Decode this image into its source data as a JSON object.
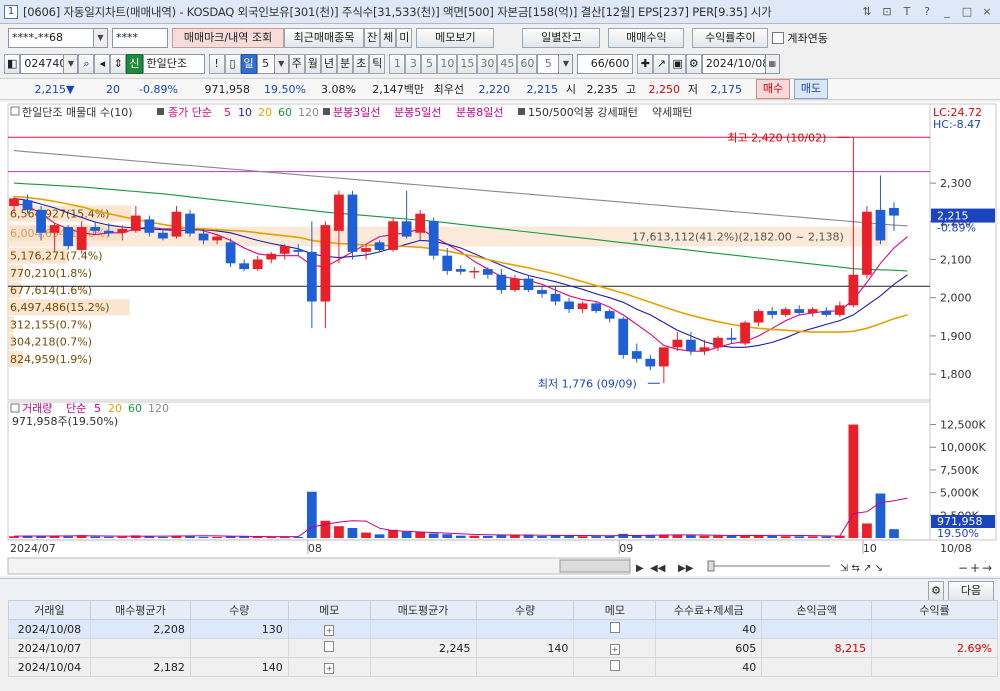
{
  "titlebar": {
    "icon": "1",
    "text": "[0606] 자동일지차트(매매내역) - KOSDAQ 외국인보유[301(천)] 주식수[31,533(천)] 액면[500] 자본금[158(억)] 결산[12월] EPS[237] PER[9.35] 시가",
    "buttons": [
      "⇅",
      "⊡",
      "T",
      "?",
      "_",
      "□",
      "×"
    ]
  },
  "toolbar1": {
    "account": "****-**68",
    "password": "****",
    "trade_mark_button": "매매마크/내역 조회",
    "recent_items_button": "최근매매종목",
    "balance_button": "잔",
    "fill_button": "체",
    "unfilled_button": "미",
    "memo_button": "메모보기",
    "daily_balance_button": "일별잔고",
    "trade_profit_button": "매매수익",
    "profit_trend_button": "수익률추이",
    "account_link_label": "계좌연동"
  },
  "toolbar2": {
    "code": "024740",
    "new_badge": "신",
    "stock_name": "한일단조",
    "period_day": "일",
    "period_count": "5",
    "periods": [
      "주",
      "월",
      "년",
      "분",
      "초",
      "틱"
    ],
    "intervals": [
      "1",
      "3",
      "5",
      "10",
      "15",
      "30",
      "45",
      "60"
    ],
    "interval_value": "5",
    "count": "66/600",
    "date": "2024/10/08"
  },
  "quotebar": {
    "price": "2,215",
    "arrow": "▼",
    "change": "20",
    "change_pct": "-0.89%",
    "volume": "971,958",
    "volume_ratio": "19.50%",
    "turnover": "3.08%",
    "amount": "2,147백만",
    "best_ask_label": "최우선",
    "best_ask": "2,220",
    "best_bid": "2,215",
    "open_label": "시",
    "open": "2,235",
    "high_label": "고",
    "high": "2,250",
    "low_label": "저",
    "low": "2,175",
    "buy_button": "매수",
    "sell_button": "매도"
  },
  "legend": {
    "series_title": "한일단조 매물대 수(10)",
    "ma_label": "종가 단순",
    "ma_periods": [
      "5",
      "10",
      "20",
      "60",
      "120"
    ],
    "vwap3": "분봉3일선",
    "vwap5": "분봉5일선",
    "vwap8": "분봉8일선",
    "pattern": "150/500억봉 강세패턴",
    "pattern2": "약세패턴"
  },
  "annotations": {
    "lc": "LC:24.72",
    "hc": "HC:-8.47",
    "high_mark": "최고 2,420 (10/02)",
    "low_mark": "최저 1,776 (09/09)",
    "price_tag": "2,215",
    "price_tag_pct": "-0.89%",
    "vol_tag": "971,958",
    "vol_tag_pct": "19.50%",
    "vol_legend_title": "거래량",
    "vol_legend_ma": "단순",
    "vol_ma_periods": [
      "5",
      "20",
      "60",
      "120"
    ],
    "vol_current": "971,958주(19.50%)"
  },
  "profile": [
    {
      "label": "6,564,927(15.4%)",
      "price": 2220
    },
    {
      "label": "6,004,694(14.0%)",
      "price": 2170
    },
    {
      "label": "5,176,271(7.4%)",
      "price": 2110
    },
    {
      "label": "770,210(1.8%)",
      "price": 2065
    },
    {
      "label": "677,614(1.6%)",
      "price": 2020
    },
    {
      "label": "6,497,486(15.2%)",
      "price": 1975
    },
    {
      "label": "312,155(0.7%)",
      "price": 1930
    },
    {
      "label": "304,218(0.7%)",
      "price": 1885
    },
    {
      "label": "824,959(1.9%)",
      "price": 1840
    }
  ],
  "profile_highlight": "17,613,112(41.2%)(2,182.00 ~ 2,138)",
  "chart_data": {
    "type": "candlestick",
    "price_axis": {
      "ticks": [
        "2,300",
        "2,200",
        "2,100",
        "2,000",
        "1,900",
        "1,800"
      ],
      "ylim": [
        1740,
        2460
      ]
    },
    "volume_axis": {
      "ticks": [
        "12,500K",
        "10,000K",
        "7,500K",
        "5,000K",
        "2,500K"
      ],
      "ylim": [
        0,
        13000
      ]
    },
    "date_labels": [
      "2024/07",
      "08",
      "09",
      "10",
      "10/08"
    ],
    "candles": [
      {
        "o": 2240,
        "h": 2265,
        "l": 2225,
        "c": 2260,
        "v": 190
      },
      {
        "o": 2255,
        "h": 2270,
        "l": 2220,
        "c": 2230,
        "v": 170
      },
      {
        "o": 2230,
        "h": 2240,
        "l": 2150,
        "c": 2170,
        "v": 260
      },
      {
        "o": 2170,
        "h": 2195,
        "l": 2120,
        "c": 2190,
        "v": 210
      },
      {
        "o": 2185,
        "h": 2190,
        "l": 2125,
        "c": 2135,
        "v": 180
      },
      {
        "o": 2125,
        "h": 2200,
        "l": 2115,
        "c": 2185,
        "v": 310
      },
      {
        "o": 2185,
        "h": 2200,
        "l": 2165,
        "c": 2175,
        "v": 160
      },
      {
        "o": 2175,
        "h": 2195,
        "l": 2160,
        "c": 2168,
        "v": 140
      },
      {
        "o": 2170,
        "h": 2190,
        "l": 2150,
        "c": 2180,
        "v": 150
      },
      {
        "o": 2175,
        "h": 2240,
        "l": 2170,
        "c": 2215,
        "v": 290
      },
      {
        "o": 2205,
        "h": 2215,
        "l": 2160,
        "c": 2170,
        "v": 220
      },
      {
        "o": 2170,
        "h": 2180,
        "l": 2150,
        "c": 2155,
        "v": 130
      },
      {
        "o": 2160,
        "h": 2240,
        "l": 2155,
        "c": 2225,
        "v": 260
      },
      {
        "o": 2220,
        "h": 2230,
        "l": 2160,
        "c": 2168,
        "v": 230
      },
      {
        "o": 2168,
        "h": 2180,
        "l": 2140,
        "c": 2150,
        "v": 130
      },
      {
        "o": 2150,
        "h": 2165,
        "l": 2140,
        "c": 2160,
        "v": 120
      },
      {
        "o": 2145,
        "h": 2155,
        "l": 2080,
        "c": 2090,
        "v": 200
      },
      {
        "o": 2090,
        "h": 2100,
        "l": 2070,
        "c": 2075,
        "v": 170
      },
      {
        "o": 2075,
        "h": 2110,
        "l": 2070,
        "c": 2100,
        "v": 150
      },
      {
        "o": 2100,
        "h": 2120,
        "l": 2090,
        "c": 2115,
        "v": 140
      },
      {
        "o": 2115,
        "h": 2140,
        "l": 2100,
        "c": 2135,
        "v": 120
      },
      {
        "o": 2125,
        "h": 2140,
        "l": 2110,
        "c": 2120,
        "v": 110
      },
      {
        "o": 2120,
        "h": 2200,
        "l": 1920,
        "c": 1990,
        "v": 5100
      },
      {
        "o": 1990,
        "h": 2200,
        "l": 1920,
        "c": 2190,
        "v": 1900
      },
      {
        "o": 2175,
        "h": 2280,
        "l": 2090,
        "c": 2270,
        "v": 1300
      },
      {
        "o": 2270,
        "h": 2280,
        "l": 2100,
        "c": 2120,
        "v": 1100
      },
      {
        "o": 2120,
        "h": 2140,
        "l": 2100,
        "c": 2130,
        "v": 600
      },
      {
        "o": 2145,
        "h": 2150,
        "l": 2120,
        "c": 2125,
        "v": 400
      },
      {
        "o": 2125,
        "h": 2210,
        "l": 2120,
        "c": 2200,
        "v": 900
      },
      {
        "o": 2200,
        "h": 2280,
        "l": 2155,
        "c": 2160,
        "v": 700
      },
      {
        "o": 2170,
        "h": 2230,
        "l": 2150,
        "c": 2220,
        "v": 650
      },
      {
        "o": 2200,
        "h": 2210,
        "l": 2100,
        "c": 2110,
        "v": 500
      },
      {
        "o": 2110,
        "h": 2130,
        "l": 2060,
        "c": 2070,
        "v": 420
      },
      {
        "o": 2075,
        "h": 2085,
        "l": 2060,
        "c": 2068,
        "v": 260
      },
      {
        "o": 2068,
        "h": 2080,
        "l": 2050,
        "c": 2070,
        "v": 250
      },
      {
        "o": 2075,
        "h": 2080,
        "l": 2050,
        "c": 2060,
        "v": 230
      },
      {
        "o": 2060,
        "h": 2075,
        "l": 2010,
        "c": 2020,
        "v": 330
      },
      {
        "o": 2020,
        "h": 2060,
        "l": 2015,
        "c": 2050,
        "v": 310
      },
      {
        "o": 2050,
        "h": 2060,
        "l": 2015,
        "c": 2020,
        "v": 290
      },
      {
        "o": 2020,
        "h": 2030,
        "l": 2000,
        "c": 2010,
        "v": 220
      },
      {
        "o": 2010,
        "h": 2030,
        "l": 1980,
        "c": 1990,
        "v": 300
      },
      {
        "o": 1990,
        "h": 2000,
        "l": 1960,
        "c": 1970,
        "v": 260
      },
      {
        "o": 1970,
        "h": 1990,
        "l": 1960,
        "c": 1985,
        "v": 200
      },
      {
        "o": 1985,
        "h": 1990,
        "l": 1960,
        "c": 1965,
        "v": 210
      },
      {
        "o": 1965,
        "h": 1970,
        "l": 1935,
        "c": 1945,
        "v": 250
      },
      {
        "o": 1945,
        "h": 1950,
        "l": 1840,
        "c": 1850,
        "v": 460
      },
      {
        "o": 1860,
        "h": 1880,
        "l": 1830,
        "c": 1840,
        "v": 320
      },
      {
        "o": 1840,
        "h": 1850,
        "l": 1810,
        "c": 1820,
        "v": 280
      },
      {
        "o": 1820,
        "h": 1870,
        "l": 1776,
        "c": 1870,
        "v": 380
      },
      {
        "o": 1870,
        "h": 1910,
        "l": 1860,
        "c": 1890,
        "v": 330
      },
      {
        "o": 1890,
        "h": 1910,
        "l": 1850,
        "c": 1860,
        "v": 300
      },
      {
        "o": 1860,
        "h": 1890,
        "l": 1850,
        "c": 1870,
        "v": 250
      },
      {
        "o": 1870,
        "h": 1900,
        "l": 1860,
        "c": 1895,
        "v": 260
      },
      {
        "o": 1895,
        "h": 1920,
        "l": 1880,
        "c": 1890,
        "v": 240
      },
      {
        "o": 1880,
        "h": 1940,
        "l": 1875,
        "c": 1935,
        "v": 330
      },
      {
        "o": 1935,
        "h": 1970,
        "l": 1925,
        "c": 1965,
        "v": 340
      },
      {
        "o": 1965,
        "h": 1975,
        "l": 1945,
        "c": 1955,
        "v": 220
      },
      {
        "o": 1955,
        "h": 1975,
        "l": 1950,
        "c": 1970,
        "v": 200
      },
      {
        "o": 1970,
        "h": 1980,
        "l": 1955,
        "c": 1960,
        "v": 190
      },
      {
        "o": 1960,
        "h": 1975,
        "l": 1950,
        "c": 1970,
        "v": 180
      },
      {
        "o": 1965,
        "h": 1975,
        "l": 1950,
        "c": 1955,
        "v": 170
      },
      {
        "o": 1955,
        "h": 1990,
        "l": 1950,
        "c": 1980,
        "v": 260
      },
      {
        "o": 1980,
        "h": 2420,
        "l": 1975,
        "c": 2060,
        "v": 12500
      },
      {
        "o": 2060,
        "h": 2240,
        "l": 2050,
        "c": 2225,
        "v": 1600
      },
      {
        "o": 2230,
        "h": 2320,
        "l": 2140,
        "c": 2150,
        "v": 4900
      },
      {
        "o": 2235,
        "h": 2250,
        "l": 2175,
        "c": 2215,
        "v": 972
      }
    ],
    "ma_lines": [
      {
        "name": "5",
        "color": "#e4007f",
        "values": [
          2248,
          2240,
          2220,
          2195,
          2180,
          2170,
          2165,
          2170,
          2170,
          2180,
          2185,
          2180,
          2180,
          2185,
          2175,
          2165,
          2150,
          2130,
          2115,
          2110,
          2110,
          2110,
          2085,
          2080,
          2100,
          2120,
          2140,
          2160,
          2165,
          2170,
          2180,
          2160,
          2140,
          2120,
          2095,
          2075,
          2055,
          2050,
          2045,
          2035,
          2020,
          2005,
          1995,
          1990,
          1975,
          1955,
          1930,
          1905,
          1875,
          1865,
          1860,
          1860,
          1870,
          1880,
          1885,
          1900,
          1920,
          1940,
          1955,
          1960,
          1965,
          1965,
          1995,
          2040,
          2090,
          2130,
          2160
        ]
      },
      {
        "name": "10",
        "color": "#1e1eaa",
        "values": [
          2260,
          2255,
          2245,
          2235,
          2222,
          2210,
          2198,
          2190,
          2185,
          2182,
          2180,
          2178,
          2176,
          2177,
          2178,
          2175,
          2170,
          2160,
          2150,
          2142,
          2135,
          2128,
          2115,
          2108,
          2105,
          2108,
          2112,
          2120,
          2130,
          2140,
          2150,
          2148,
          2140,
          2130,
          2115,
          2100,
          2085,
          2070,
          2058,
          2050,
          2042,
          2032,
          2022,
          2010,
          2000,
          1988,
          1970,
          1955,
          1935,
          1915,
          1900,
          1885,
          1875,
          1870,
          1870,
          1875,
          1883,
          1895,
          1910,
          1920,
          1930,
          1940,
          1955,
          1980,
          2005,
          2035,
          2060
        ]
      },
      {
        "name": "20",
        "color": "#e6a100",
        "values": [
          2265,
          2262,
          2258,
          2252,
          2245,
          2238,
          2228,
          2220,
          2212,
          2205,
          2198,
          2192,
          2186,
          2182,
          2180,
          2178,
          2176,
          2174,
          2170,
          2166,
          2162,
          2158,
          2150,
          2145,
          2142,
          2140,
          2138,
          2137,
          2136,
          2134,
          2132,
          2128,
          2122,
          2115,
          2108,
          2100,
          2092,
          2085,
          2078,
          2070,
          2062,
          2052,
          2042,
          2032,
          2022,
          2012,
          2000,
          1988,
          1976,
          1964,
          1954,
          1945,
          1937,
          1930,
          1924,
          1920,
          1917,
          1915,
          1912,
          1910,
          1910,
          1910,
          1912,
          1920,
          1932,
          1945,
          1955
        ]
      },
      {
        "name": "60",
        "color": "#129a3e",
        "values": [
          2300,
          2298,
          2296,
          2294,
          2292,
          2290,
          2287,
          2284,
          2281,
          2278,
          2275,
          2272,
          2268,
          2264,
          2260,
          2256,
          2252,
          2248,
          2244,
          2240,
          2236,
          2232,
          2228,
          2224,
          2221,
          2218,
          2215,
          2212,
          2209,
          2206,
          2203,
          2200,
          2196,
          2192,
          2188,
          2184,
          2180,
          2176,
          2172,
          2168,
          2164,
          2160,
          2156,
          2152,
          2148,
          2144,
          2140,
          2136,
          2132,
          2128,
          2124,
          2120,
          2116,
          2112,
          2108,
          2104,
          2100,
          2096,
          2092,
          2088,
          2084,
          2080,
          2076,
          2074,
          2073,
          2072,
          2070
        ]
      },
      {
        "name": "120",
        "color": "#888888",
        "values": [
          2385,
          2382,
          2379,
          2376,
          2373,
          2370,
          2367,
          2364,
          2361,
          2358,
          2355,
          2352,
          2349,
          2346,
          2343,
          2340,
          2337,
          2334,
          2331,
          2328,
          2325,
          2322,
          2319,
          2316,
          2313,
          2310,
          2307,
          2304,
          2301,
          2298,
          2295,
          2292,
          2289,
          2286,
          2283,
          2280,
          2277,
          2274,
          2271,
          2268,
          2265,
          2262,
          2259,
          2256,
          2253,
          2250,
          2247,
          2244,
          2241,
          2238,
          2235,
          2232,
          2229,
          2226,
          2223,
          2220,
          2217,
          2214,
          2211,
          2208,
          2205,
          2202,
          2199,
          2196,
          2193,
          2190,
          2188
        ]
      }
    ],
    "vol_ma5": [
      210,
      215,
      220,
      225,
      230,
      240,
      230,
      220,
      210,
      200,
      205,
      210,
      220,
      230,
      240,
      230,
      210,
      190,
      170,
      150,
      150,
      150,
      1200,
      1500,
      1750,
      1900,
      1860,
      1080,
      800,
      740,
      660,
      610,
      540,
      470,
      400,
      360,
      340,
      330,
      330,
      300,
      290,
      280,
      270,
      260,
      250,
      270,
      280,
      300,
      330,
      340,
      340,
      330,
      310,
      280,
      270,
      280,
      290,
      290,
      280,
      260,
      230,
      210,
      2700,
      2900,
      3900,
      4100,
      4400
    ]
  },
  "table": {
    "headers": [
      "거래일",
      "매수평균가",
      "수량",
      "메모",
      "매도평균가",
      "수량",
      "메모",
      "수수료+제세금",
      "손익금액",
      "수익률"
    ],
    "rows": [
      {
        "date": "2024/10/08",
        "buy_avg": "2,208",
        "buy_qty": "130",
        "sell_avg": "",
        "sell_qty": "",
        "fee": "40",
        "pnl": "",
        "ret": ""
      },
      {
        "date": "2024/10/07",
        "buy_avg": "",
        "buy_qty": "",
        "sell_avg": "2,245",
        "sell_qty": "140",
        "fee": "605",
        "pnl": "8,215",
        "ret": "2.69%"
      },
      {
        "date": "2024/10/04",
        "buy_avg": "2,182",
        "buy_qty": "140",
        "sell_avg": "",
        "sell_qty": "",
        "fee": "40",
        "pnl": "",
        "ret": ""
      }
    ]
  },
  "panel": {
    "next_button": "다음"
  }
}
